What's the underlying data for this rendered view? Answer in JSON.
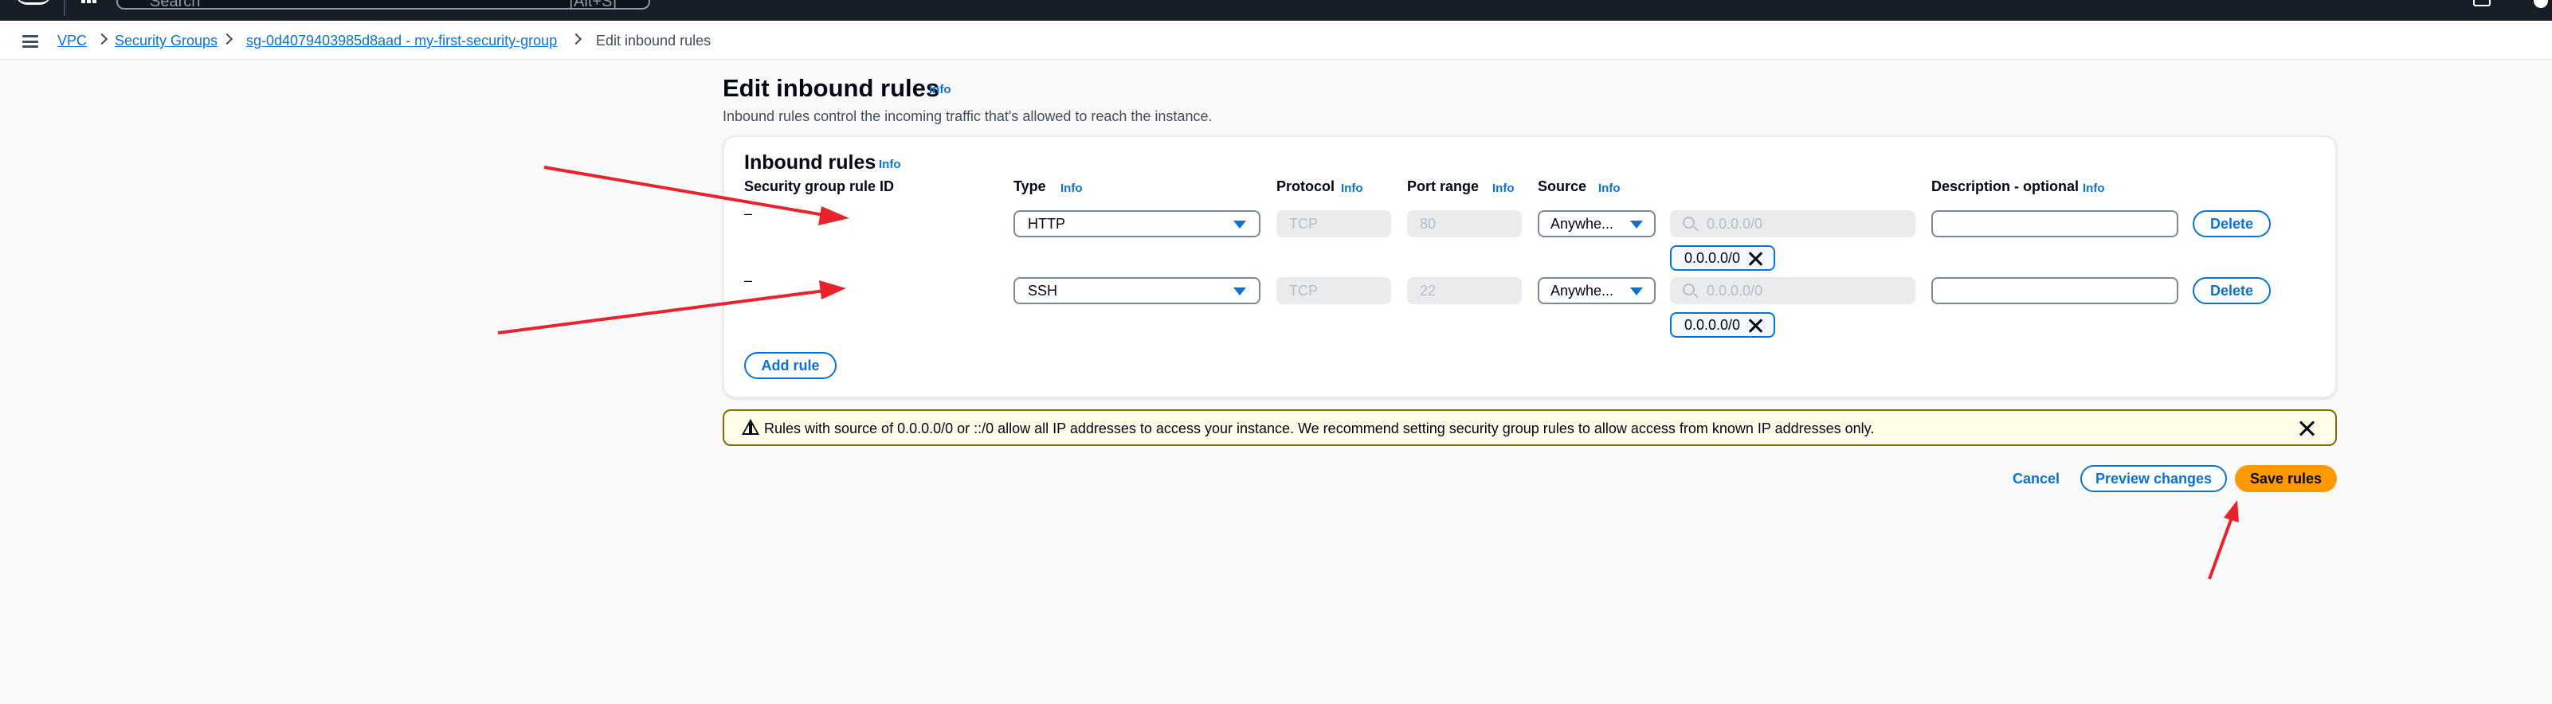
{
  "topbar": {
    "search_placeholder": "Search",
    "search_shortcut": "[Alt+S]"
  },
  "breadcrumb": {
    "items": [
      {
        "label": "VPC"
      },
      {
        "label": "Security Groups"
      },
      {
        "label": "sg-0d4079403985d8aad - my-first-security-group"
      },
      {
        "label": "Edit inbound rules"
      }
    ]
  },
  "page": {
    "title": "Edit inbound rules",
    "info": "Info",
    "description": "Inbound rules control the incoming traffic that's allowed to reach the instance."
  },
  "inbound": {
    "title": "Inbound rules",
    "info": "Info",
    "columns": {
      "rule_id": "Security group rule ID",
      "type": "Type",
      "protocol": "Protocol",
      "port_range": "Port range",
      "source": "Source",
      "description": "Description - optional",
      "info": "Info"
    },
    "rules": [
      {
        "rule_id": "–",
        "type": "HTTP",
        "protocol": "TCP",
        "port": "80",
        "source": "Anywhe...",
        "cidr_placeholder": "0.0.0.0/0",
        "token": "0.0.0.0/0",
        "description": "",
        "delete": "Delete"
      },
      {
        "rule_id": "–",
        "type": "SSH",
        "protocol": "TCP",
        "port": "22",
        "source": "Anywhe...",
        "cidr_placeholder": "0.0.0.0/0",
        "token": "0.0.0.0/0",
        "description": "",
        "delete": "Delete"
      }
    ],
    "add_rule": "Add rule"
  },
  "alert": {
    "message": "Rules with source of 0.0.0.0/0 or ::/0 allow all IP addresses to access your instance. We recommend setting security group rules to allow access from known IP addresses only."
  },
  "actions": {
    "cancel": "Cancel",
    "preview": "Preview changes",
    "save": "Save rules"
  },
  "colors": {
    "accent": "#0972d3",
    "primary_button": "#ff9900",
    "annotation_arrow": "#e8232c",
    "warning_border": "#8d6605"
  }
}
